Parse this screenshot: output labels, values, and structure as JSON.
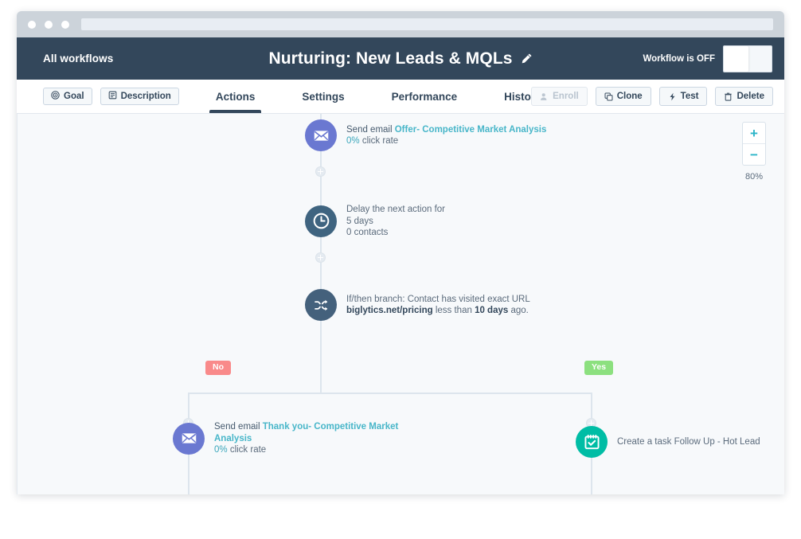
{
  "browser": {
    "dots": [
      "dot-1",
      "dot-2",
      "dot-3"
    ],
    "address_value": ""
  },
  "header": {
    "back_link": "All workflows",
    "title": "Nurturing: New Leads & MQLs",
    "edit_icon": "pencil-icon",
    "toggle_label": "Workflow is OFF",
    "toggle_state": "off"
  },
  "tabbar": {
    "pills": [
      {
        "label": "Goal",
        "icon": "target-icon"
      },
      {
        "label": "Description",
        "icon": "document-icon"
      }
    ],
    "tabs": [
      {
        "label": "Actions",
        "active": true
      },
      {
        "label": "Settings",
        "active": false
      },
      {
        "label": "Performance",
        "active": false
      },
      {
        "label": "History",
        "active": false
      }
    ],
    "actions": [
      {
        "label": "Enroll",
        "icon": "person-add-icon",
        "disabled": true
      },
      {
        "label": "Clone",
        "icon": "copy-icon",
        "disabled": false
      },
      {
        "label": "Test",
        "icon": "lightning-icon",
        "disabled": false
      },
      {
        "label": "Delete",
        "icon": "trash-icon",
        "disabled": false
      }
    ]
  },
  "canvas": {
    "zoom": {
      "increase_label": "+",
      "decrease_label": "−",
      "level": "80%"
    },
    "nodes": [
      {
        "id": "send-email-offer",
        "icon": "envelope-icon",
        "icon_color": "#6a78d1",
        "line1_prefix": "Send email ",
        "line1_highlight": "Offer- Competitive Market Analysis",
        "line2_highlight": "0%",
        "line2_rest": " click rate"
      },
      {
        "id": "delay",
        "icon": "clock-icon",
        "icon_color": "#3f6480",
        "line1": "Delay the next action for",
        "line2": "5 days",
        "line3": "0 contacts"
      },
      {
        "id": "if-then-branch",
        "icon": "shuffle-icon",
        "icon_color": "#44617c",
        "line1": "If/then branch: Contact has visited exact URL",
        "line2_a": "biglytics.net/pricing",
        "line2_b": " less than ",
        "line2_c": "10 days",
        "line2_d": " ago."
      },
      {
        "id": "send-email-thankyou",
        "icon": "envelope-icon",
        "icon_color": "#6a78d1",
        "line1_prefix": "Send email ",
        "line1_highlight": "Thank you- Competitive Market",
        "line2_highlight": "Analysis",
        "line3_highlight": "0%",
        "line3_rest": " click rate"
      },
      {
        "id": "create-task",
        "icon": "task-checklist-icon",
        "icon_color": "#00bda5",
        "line1": "Create a task Follow Up - Hot Lead"
      }
    ],
    "branch_badges": [
      {
        "label": "No",
        "kind": "no"
      },
      {
        "label": "Yes",
        "kind": "yes"
      }
    ]
  },
  "colors": {
    "header_bg": "#33475b",
    "canvas_bg": "#f7f9fb",
    "accent_teal": "#2ab4c8",
    "badge_no": "#f98a8a",
    "badge_yes": "#8ce07f",
    "email_purple": "#6a78d1",
    "task_green": "#00bda5"
  }
}
